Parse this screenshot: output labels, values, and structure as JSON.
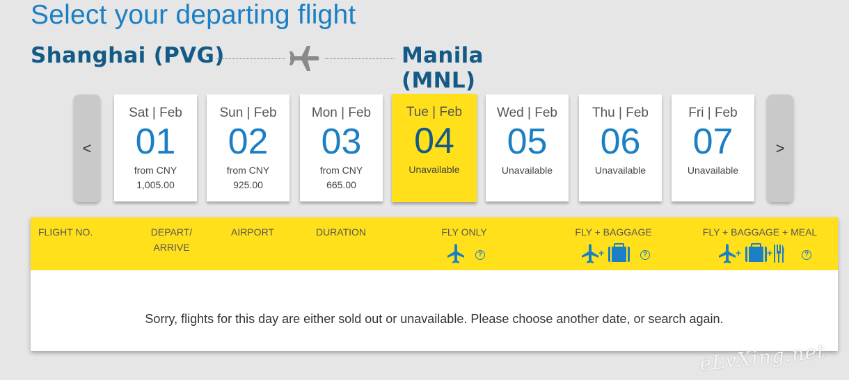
{
  "page_title": "Select your departing flight",
  "route": {
    "origin": "Shanghai (PVG)",
    "destination": "Manila (MNL)"
  },
  "carousel": {
    "prev_label": "<",
    "next_label": ">",
    "days": [
      {
        "dow": "Sat | Feb",
        "day": "01",
        "line1": "from CNY",
        "line2": "1,005.00",
        "selected": false
      },
      {
        "dow": "Sun | Feb",
        "day": "02",
        "line1": "from CNY",
        "line2": "925.00",
        "selected": false
      },
      {
        "dow": "Mon | Feb",
        "day": "03",
        "line1": "from CNY",
        "line2": "665.00",
        "selected": false
      },
      {
        "dow": "Tue | Feb",
        "day": "04",
        "line1": "Unavailable",
        "line2": "",
        "selected": true
      },
      {
        "dow": "Wed | Feb",
        "day": "05",
        "line1": "Unavailable",
        "line2": "",
        "selected": false
      },
      {
        "dow": "Thu | Feb",
        "day": "06",
        "line1": "Unavailable",
        "line2": "",
        "selected": false
      },
      {
        "dow": "Fri | Feb",
        "day": "07",
        "line1": "Unavailable",
        "line2": "",
        "selected": false
      }
    ]
  },
  "table": {
    "headers": {
      "flight_no": "FLIGHT NO.",
      "depart_arrive_1": "DEPART/",
      "depart_arrive_2": "ARRIVE",
      "airport": "AIRPORT",
      "duration": "DURATION",
      "fly_only": "FLY ONLY",
      "fly_baggage": "FLY + BAGGAGE",
      "fly_baggage_meal": "FLY + BAGGAGE + MEAL"
    },
    "help_glyph": "?",
    "empty_message": "Sorry, flights for this day are either sold out or unavailable. Please choose another date, or search again."
  },
  "watermark": "eLvXing.net",
  "colors": {
    "accent_blue": "#1b7fc4",
    "dark_blue": "#135a87",
    "yellow": "#ffe01b",
    "background": "#e6e6e6"
  },
  "icons": [
    "plane-icon",
    "suitcase-icon",
    "fork-knife-icon",
    "help-icon",
    "chevron-left-icon",
    "chevron-right-icon"
  ]
}
